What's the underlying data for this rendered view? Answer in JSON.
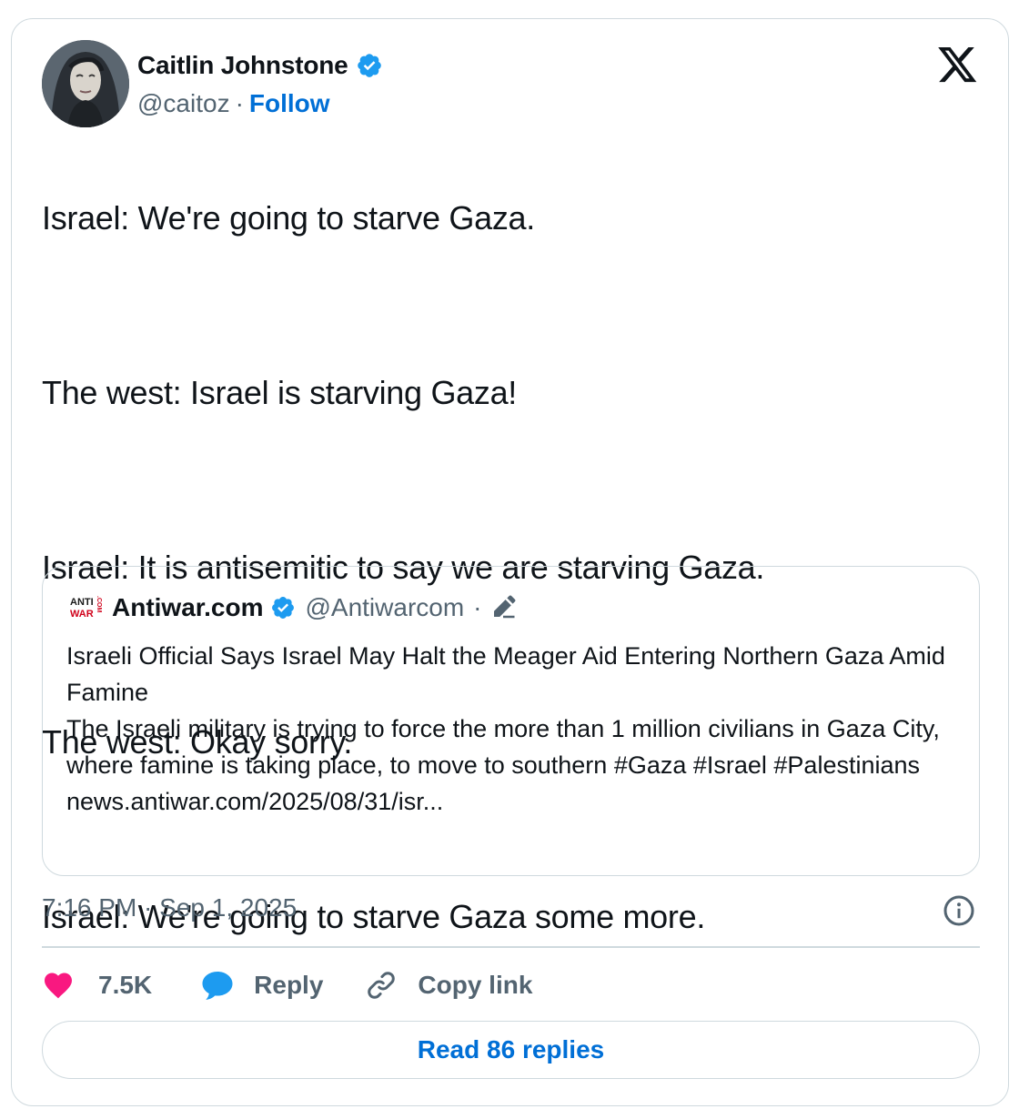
{
  "author": {
    "name": "Caitlin Johnstone",
    "handle": "@caitoz",
    "separator": "·",
    "follow_label": "Follow"
  },
  "tweet": {
    "lines": [
      "Israel: We're going to starve Gaza.",
      "The west: Israel is starving Gaza!",
      "Israel: It is antisemitic to say we are starving Gaza.",
      "The west: Okay sorry.",
      "Israel: We're going to starve Gaza some more."
    ]
  },
  "quote": {
    "logo_text_top": "ANTI",
    "logo_text_bottom": "WAR",
    "logo_text_side": ".COM",
    "name": "Antiwar.com",
    "handle": "@Antiwarcom",
    "separator": "·",
    "headline": "Israeli Official Says Israel May Halt the Meager Aid Entering Northern Gaza Amid Famine",
    "body": "The Israeli military is trying to force the more than 1 million civilians in Gaza City, where famine is taking place, to move to southern #Gaza #Israel #Palestinians",
    "link": "news.antiwar.com/2025/08/31/isr..."
  },
  "meta": {
    "timestamp": "7:16 PM · Sep 1, 2025"
  },
  "actions": {
    "likes": "7.5K",
    "reply_label": "Reply",
    "copy_label": "Copy link"
  },
  "footer": {
    "read_replies": "Read 86 replies"
  },
  "colors": {
    "link_blue": "#006fd6",
    "verified_blue": "#1d9bf0",
    "heart_pink": "#f91880",
    "muted": "#536471",
    "border": "#cfd9de"
  }
}
